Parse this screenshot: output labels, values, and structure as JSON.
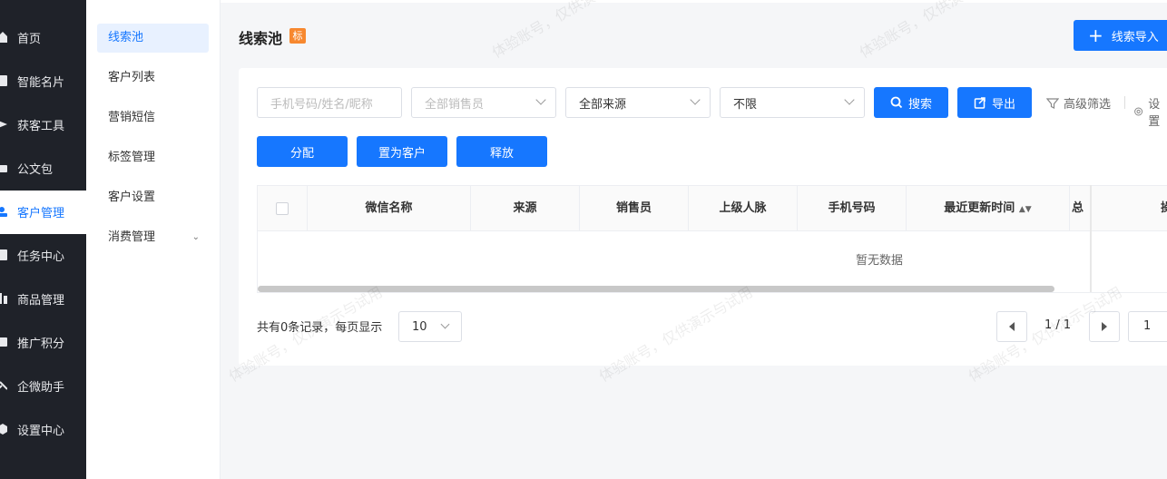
{
  "sidebar": {
    "items": [
      {
        "label": "首页",
        "icon": "home-icon"
      },
      {
        "label": "智能名片",
        "icon": "card-icon"
      },
      {
        "label": "获客工具",
        "icon": "tools-icon"
      },
      {
        "label": "公文包",
        "icon": "briefcase-icon"
      },
      {
        "label": "客户管理",
        "icon": "users-icon",
        "active": true
      },
      {
        "label": "任务中心",
        "icon": "task-icon"
      },
      {
        "label": "商品管理",
        "icon": "goods-icon"
      },
      {
        "label": "推广积分",
        "icon": "points-icon"
      },
      {
        "label": "企微助手",
        "icon": "assistant-icon"
      },
      {
        "label": "设置中心",
        "icon": "settings-icon"
      }
    ]
  },
  "subnav": {
    "items": [
      {
        "label": "线索池",
        "active": true
      },
      {
        "label": "客户列表"
      },
      {
        "label": "营销短信"
      },
      {
        "label": "标签管理"
      },
      {
        "label": "客户设置"
      },
      {
        "label": "消费管理",
        "expandable": true
      }
    ]
  },
  "header": {
    "title": "线索池",
    "badge": "标",
    "import_button": "线索导入"
  },
  "filters": {
    "search_placeholder": "手机号码/姓名/昵称",
    "sales_placeholder": "全部销售员",
    "source_value": "全部来源",
    "limit_value": "不限",
    "search_button": "搜索",
    "export_button": "导出",
    "advanced_filter": "高级筛选",
    "settings": "设置"
  },
  "actions": {
    "assign": "分配",
    "to_customer": "置为客户",
    "release": "释放"
  },
  "table": {
    "columns": [
      "微信名称",
      "来源",
      "销售员",
      "上级人脉",
      "手机号码",
      "最近更新时间",
      "总",
      "操作"
    ],
    "empty_text": "暂无数据"
  },
  "pagination": {
    "summary": "共有0条记录，每页显示",
    "page_size": "10",
    "current": "1 / 1",
    "goto_value": "1"
  },
  "watermark": "体验账号，仅供演示与试用",
  "colors": {
    "primary": "#1677ff",
    "sidebar_bg": "#1f2229",
    "badge": "#f7882f"
  }
}
